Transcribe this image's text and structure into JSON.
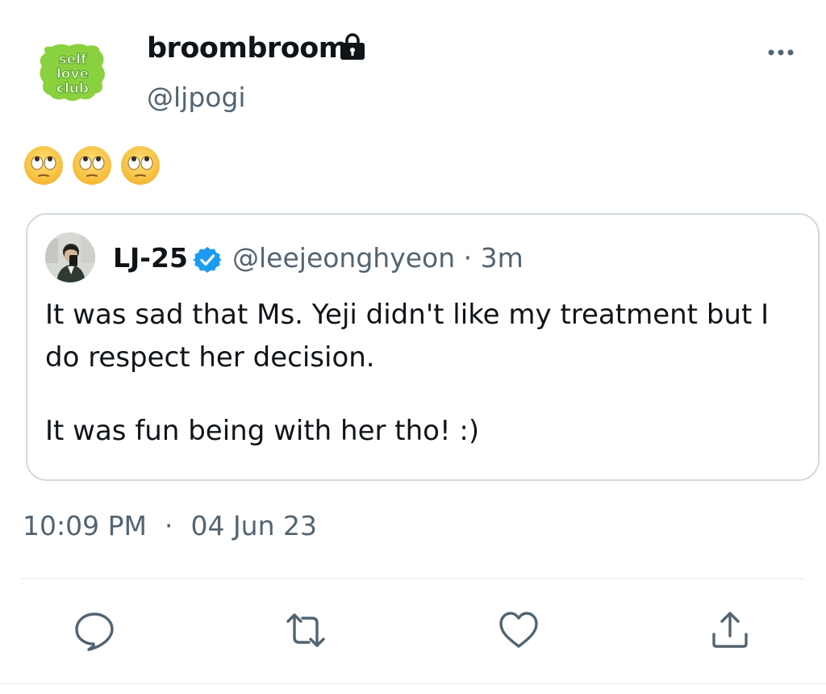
{
  "author": {
    "display_name": "broombroom",
    "handle": "@ljpogi",
    "avatar_text": "self love club",
    "avatar_icon": "self-love-club-logo",
    "protected_icon": "lock-icon"
  },
  "tweet": {
    "emojis": [
      "🙄",
      "🙄",
      "🙄"
    ],
    "timestamp_time": "10:09 PM",
    "timestamp_separator": "·",
    "timestamp_date": "04 Jun 23"
  },
  "quote": {
    "display_name": "LJ-25",
    "verified_icon": "verified-badge-icon",
    "handle": "@leejeonghyeon",
    "separator": "·",
    "time": "3m",
    "paragraph_1": "It was sad that Ms. Yeji didn't like my treatment but I do respect her decision.",
    "paragraph_2": "It was fun being with her tho! :)"
  },
  "actions": {
    "reply_icon": "reply-icon",
    "retweet_icon": "retweet-icon",
    "like_icon": "heart-icon",
    "share_icon": "share-icon",
    "more_icon": "more-icon"
  },
  "colors": {
    "text": "#0f1419",
    "secondary": "#536471",
    "verified": "#1d9bf0",
    "logo_green": "#8ad13f",
    "border": "#cfd9de"
  }
}
